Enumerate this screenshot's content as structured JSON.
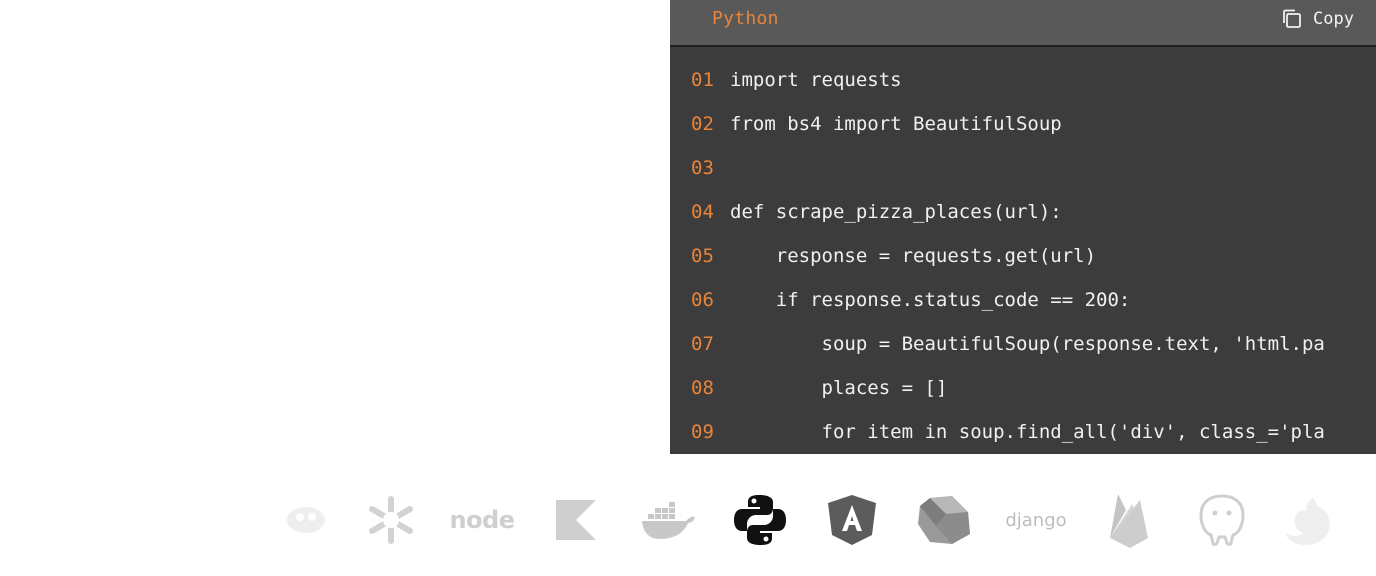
{
  "code_block": {
    "language": "Python",
    "copy_label": "Copy",
    "lines": [
      {
        "no": "01",
        "code": "import requests"
      },
      {
        "no": "02",
        "code": "from bs4 import BeautifulSoup"
      },
      {
        "no": "03",
        "code": ""
      },
      {
        "no": "04",
        "code": "def scrape_pizza_places(url):"
      },
      {
        "no": "05",
        "code": "    response = requests.get(url)"
      },
      {
        "no": "06",
        "code": "    if response.status_code == 200:"
      },
      {
        "no": "07",
        "code": "        soup = BeautifulSoup(response.text, 'html.pa"
      },
      {
        "no": "08",
        "code": "        places = []"
      },
      {
        "no": "09",
        "code": "        for item in soup.find_all('div', class_='pla"
      }
    ]
  },
  "logos": {
    "node_text": "node",
    "django_text": "django",
    "items": [
      "go-icon",
      "nix-icon",
      "nodejs-icon",
      "kotlin-icon",
      "docker-icon",
      "python-icon",
      "angular-icon",
      "dart-icon",
      "django-icon",
      "firebase-icon",
      "postgresql-icon",
      "nestjs-icon"
    ]
  },
  "colors": {
    "line_number": "#e8843a",
    "code_text": "#f0f0f0",
    "panel_bg": "#3c3c3c",
    "header_bg": "#595959",
    "logo_active": "#111111",
    "logo_muted": "#cfcfcf"
  }
}
